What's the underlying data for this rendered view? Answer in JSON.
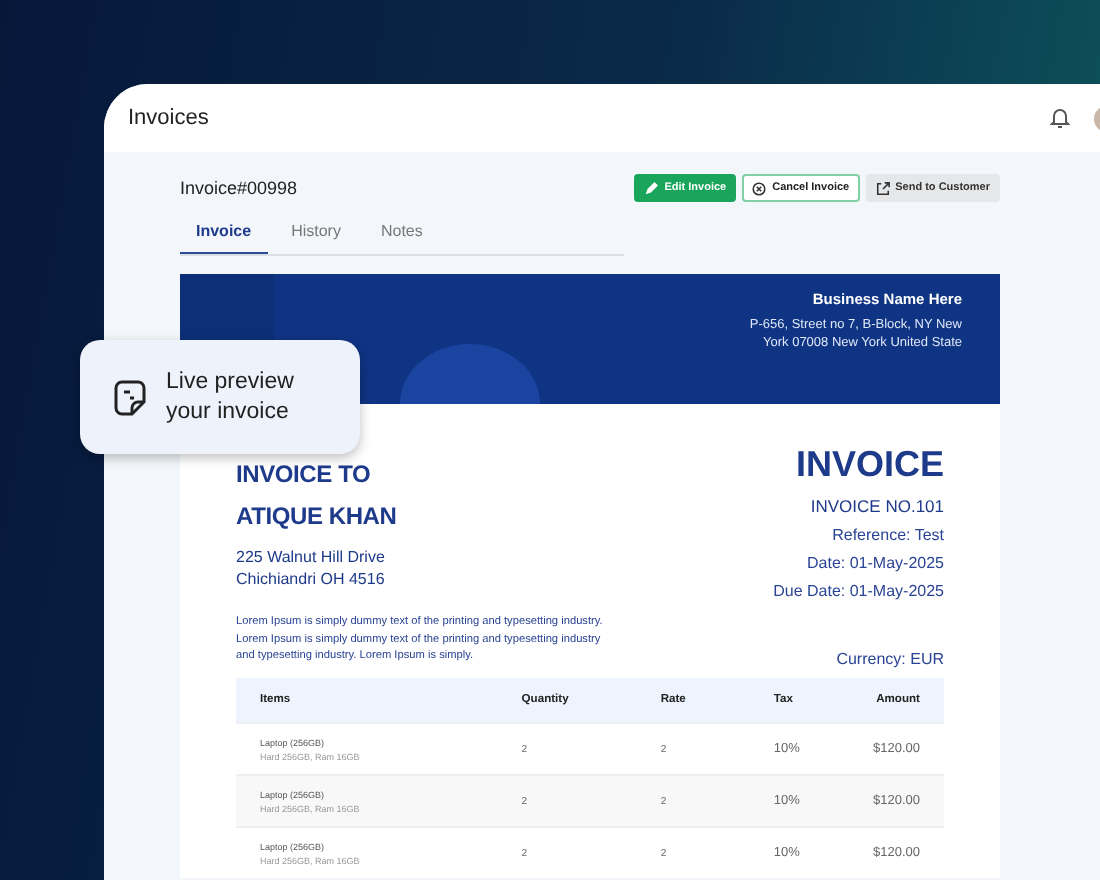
{
  "app_bar": {
    "title": "Invoices"
  },
  "invoice_header": {
    "number": "Invoice#00998",
    "actions": [
      {
        "label": "Edit Invoice",
        "kind": "primary"
      },
      {
        "label": "Cancel Invoice",
        "kind": "outline"
      },
      {
        "label": "Send to Customer",
        "kind": "muted"
      }
    ]
  },
  "tabs": [
    {
      "label": "Invoice",
      "selected": true
    },
    {
      "label": "History",
      "selected": false
    },
    {
      "label": "Notes",
      "selected": false
    }
  ],
  "business": {
    "name": "Business Name Here",
    "address": "P-656, Street no 7, B-Block, NY New York 07008 New York United State"
  },
  "bill_to": {
    "heading": "INVOICE TO",
    "name": "ATIQUE KHAN",
    "address_lines": [
      "225 Walnut Hill Drive",
      "Chichiandri OH 4516"
    ],
    "note": "Lorem Ipsum is simply dummy text of the printing and typesetting industry. Lorem Ipsum is simply dummy text of the printing and typesetting industry and typesetting industry. Lorem Ipsum is simply."
  },
  "invoice_meta": {
    "title": "INVOICE",
    "number": "INVOICE NO.101",
    "lines": [
      "Reference: Test",
      "Date: 01-May-2025",
      "Due Date: 01-May-2025"
    ],
    "currency": "Currency: EUR"
  },
  "table": {
    "columns": [
      "Items",
      "Quantity",
      "Rate",
      "Tax",
      "Amount"
    ],
    "rows": [
      {
        "item": "Laptop (256GB)",
        "detail": "Hard 256GB, Ram 16GB",
        "quantity": "2",
        "rate": "2",
        "tax": "10%",
        "amount": "$120.00"
      },
      {
        "item": "Laptop (256GB)",
        "detail": "Hard 256GB, Ram 16GB",
        "quantity": "2",
        "rate": "2",
        "tax": "10%",
        "amount": "$120.00"
      },
      {
        "item": "Laptop (256GB)",
        "detail": "Hard 256GB, Ram 16GB",
        "quantity": "2",
        "rate": "2",
        "tax": "10%",
        "amount": "$120.00"
      }
    ]
  },
  "callout": {
    "text": "Live preview your invoice"
  }
}
